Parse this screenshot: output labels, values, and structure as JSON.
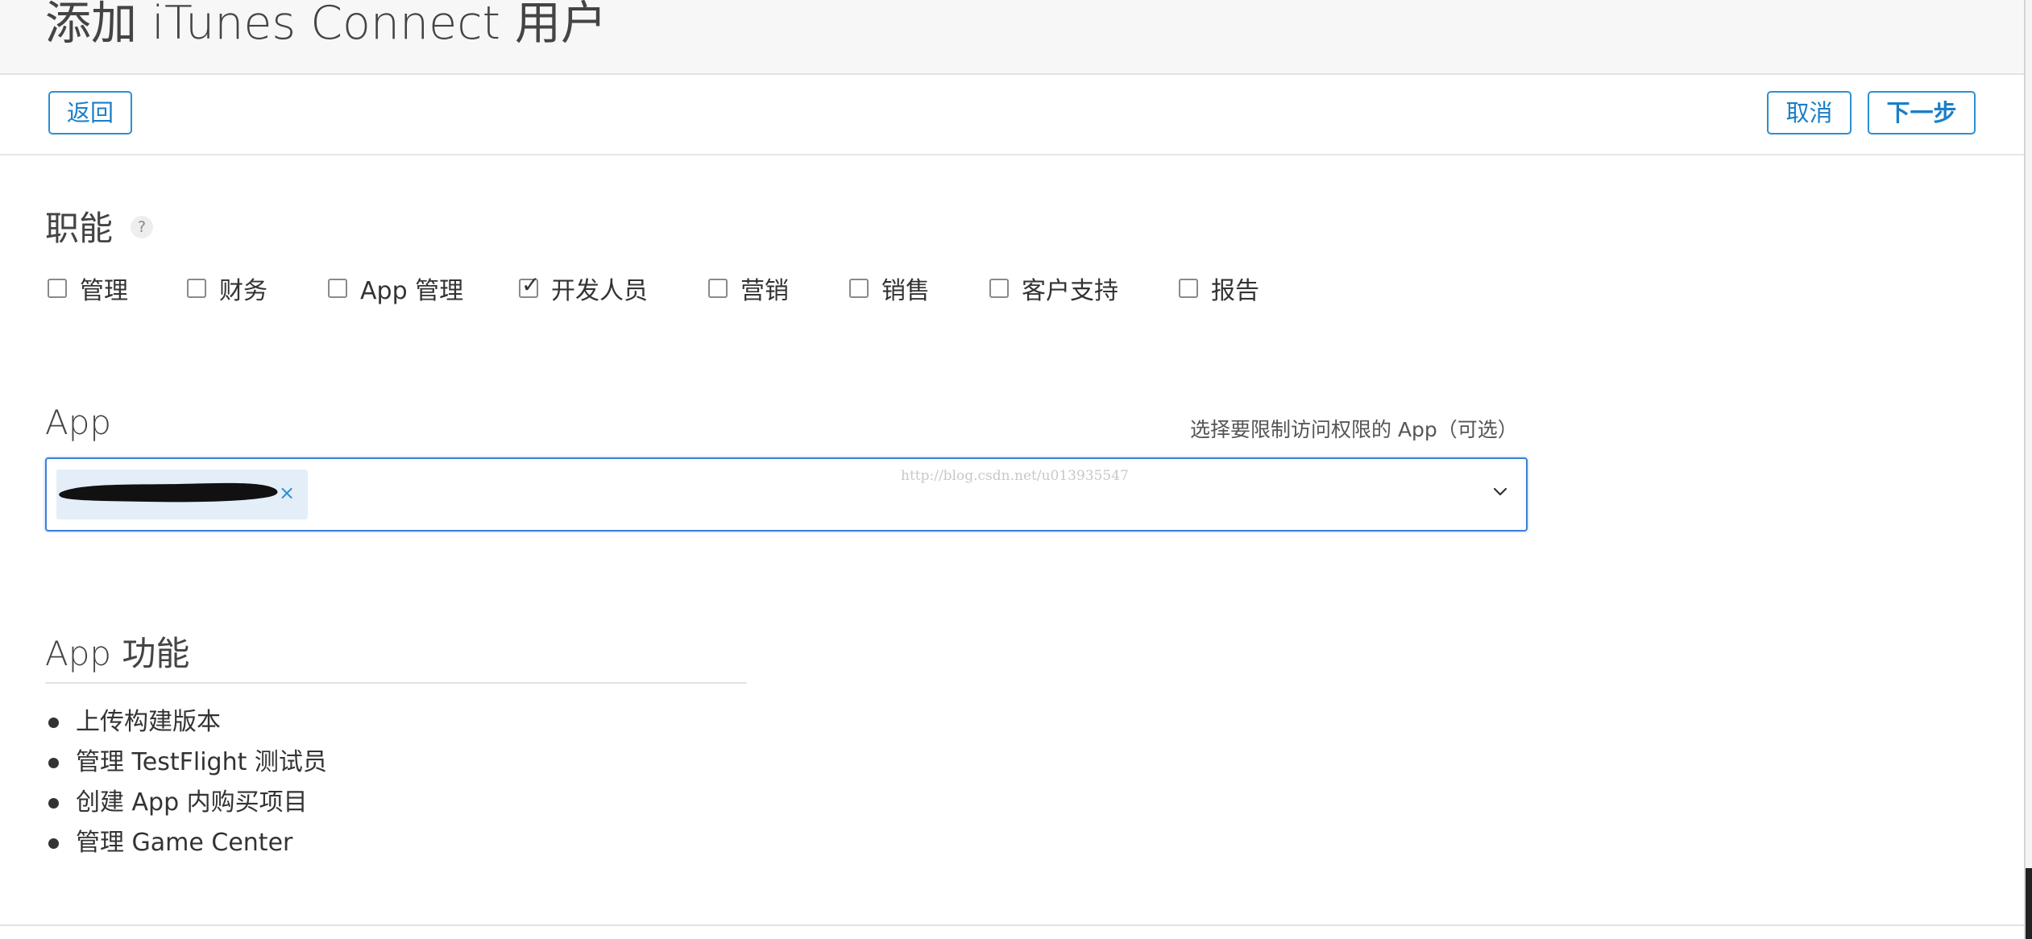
{
  "page": {
    "title": "添加 iTunes Connect 用户"
  },
  "toolbar": {
    "back_label": "返回",
    "cancel_label": "取消",
    "next_label": "下一步"
  },
  "roles": {
    "heading": "职能",
    "help_label": "?",
    "items": [
      {
        "label": "管理",
        "checked": false
      },
      {
        "label": "财务",
        "checked": false
      },
      {
        "label": "App 管理",
        "checked": false
      },
      {
        "label": "开发人员",
        "checked": true
      },
      {
        "label": "营销",
        "checked": false
      },
      {
        "label": "销售",
        "checked": false
      },
      {
        "label": "客户支持",
        "checked": false
      },
      {
        "label": "报告",
        "checked": false
      }
    ],
    "check_glyph": "✓"
  },
  "apps": {
    "heading": "App",
    "hint": "选择要限制访问权限的 App（可选）",
    "selected_token_remove": "×",
    "watermark": "http://blog.csdn.net/u013935547",
    "dropdown_icon": "chevron-down-icon"
  },
  "features": {
    "heading": "App 功能",
    "items": [
      "上传构建版本",
      "管理 TestFlight 测试员",
      "创建 App 内购买项目",
      "管理 Game Center"
    ]
  },
  "colors": {
    "accent": "#2c8fd3",
    "focus_border": "#3b82d6",
    "token_bg": "#e3eef9",
    "title_bar_bg": "#f7f7f7"
  }
}
